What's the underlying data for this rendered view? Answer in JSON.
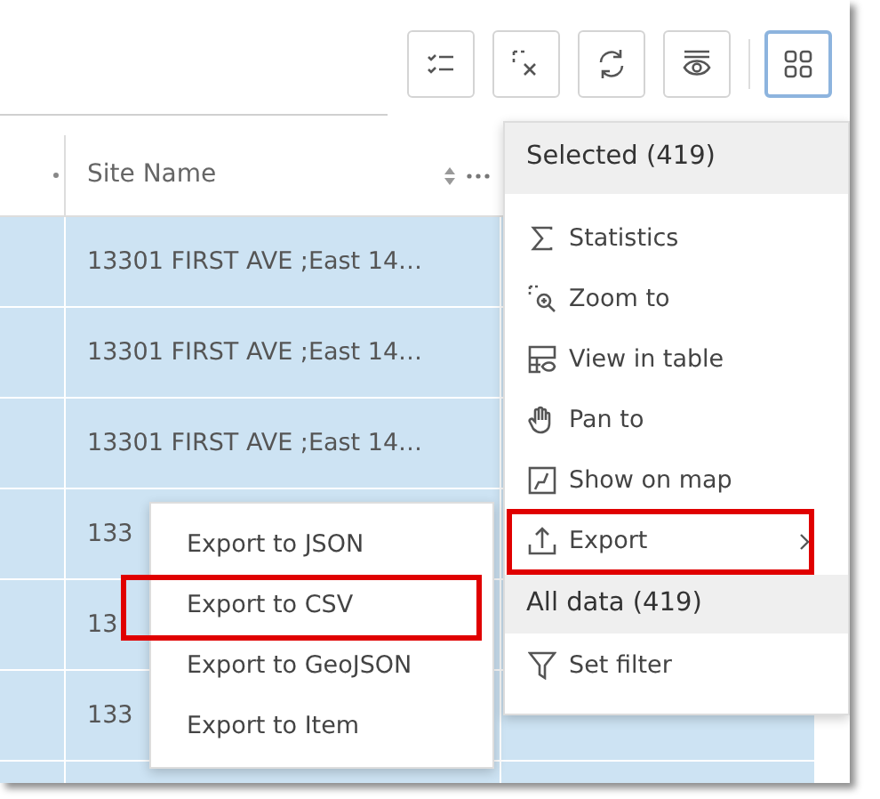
{
  "toolbar": {
    "buttons": [
      {
        "kind": "checklist",
        "selected": false
      },
      {
        "kind": "clear-selection",
        "selected": false
      },
      {
        "kind": "refresh",
        "selected": false
      },
      {
        "kind": "visibility",
        "selected": false
      },
      {
        "kind": "grid",
        "selected": true
      }
    ]
  },
  "table": {
    "columns": [
      {
        "label": "Site Name"
      }
    ],
    "rows": [
      {
        "site_name": "13301 FIRST AVE ;East 14…",
        "selected": true
      },
      {
        "site_name": "13301 FIRST AVE ;East 14…",
        "selected": true
      },
      {
        "site_name": "13301 FIRST AVE ;East 14…",
        "selected": true
      },
      {
        "site_name": "133",
        "selected": true
      },
      {
        "site_name": "13",
        "selected": true
      },
      {
        "site_name": "133",
        "selected": true
      },
      {
        "selected": true
      }
    ]
  },
  "menu": {
    "sections": [
      {
        "title": "Selected (419)",
        "items": [
          {
            "label": "Statistics",
            "highlighted": false
          },
          {
            "label": "Zoom to",
            "highlighted": false
          },
          {
            "label": "View in table",
            "highlighted": false
          },
          {
            "label": "Pan to",
            "highlighted": false
          },
          {
            "label": "Show on map",
            "highlighted": false
          },
          {
            "label": "Export",
            "has_submenu": true,
            "highlighted": true
          }
        ]
      },
      {
        "title": "All data (419)",
        "items": [
          {
            "label": "Set filter",
            "highlighted": false
          }
        ]
      }
    ]
  },
  "submenu": {
    "items": [
      {
        "label": "Export to JSON",
        "highlighted": false
      },
      {
        "label": "Export to CSV",
        "highlighted": true
      },
      {
        "label": "Export to GeoJSON",
        "highlighted": false
      },
      {
        "label": "Export to Item",
        "highlighted": false
      }
    ]
  }
}
